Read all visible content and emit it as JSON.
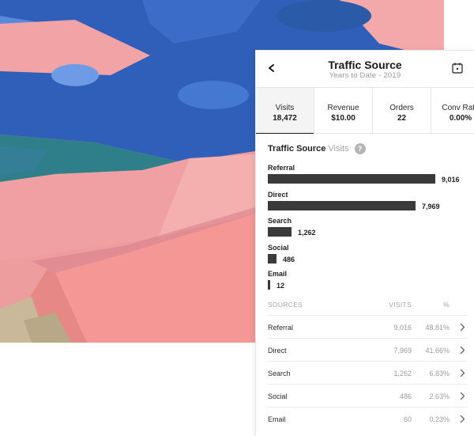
{
  "header": {
    "title": "Traffic Source",
    "subtitle": "Years to Date - 2019",
    "back_icon": "chevron-left-icon",
    "calendar_icon": "calendar-icon"
  },
  "tabs": [
    {
      "label": "Visits",
      "value": "18,472",
      "active": true
    },
    {
      "label": "Revenue",
      "value": "$10.00",
      "active": false
    },
    {
      "label": "Orders",
      "value": "22",
      "active": false
    },
    {
      "label": "Conv Rate",
      "value": "0.00%",
      "active": false
    }
  ],
  "section": {
    "title": "Traffic Source",
    "metric": "Visits",
    "help": "?"
  },
  "chart_data": {
    "type": "bar",
    "orientation": "horizontal",
    "categories": [
      "Referral",
      "Direct",
      "Search",
      "Social",
      "Email"
    ],
    "values": [
      9016,
      7969,
      1262,
      486,
      12
    ],
    "value_labels": [
      "9,016",
      "7,969",
      "1,262",
      "486",
      "12"
    ],
    "bar_color": "#3a3a3a"
  },
  "table": {
    "headers": [
      "SOURCES",
      "VISITS",
      "%"
    ],
    "rows": [
      {
        "source": "Referral",
        "visits": "9,016",
        "pct": "48.81%"
      },
      {
        "source": "Direct",
        "visits": "7,969",
        "pct": "41.66%"
      },
      {
        "source": "Search",
        "visits": "1,262",
        "pct": "6.83%"
      },
      {
        "source": "Social",
        "visits": "486",
        "pct": "2.63%"
      },
      {
        "source": "Email",
        "visits": "60",
        "pct": "0.23%"
      }
    ],
    "row_icon": "chevron-right-icon"
  },
  "colors": {
    "accent": "#1a1a1a",
    "muted_text": "#9a9a9a",
    "rug_blue": "#2f5fb8",
    "rug_pink": "#ee9d9f",
    "rug_teal": "#2e7f8a"
  }
}
